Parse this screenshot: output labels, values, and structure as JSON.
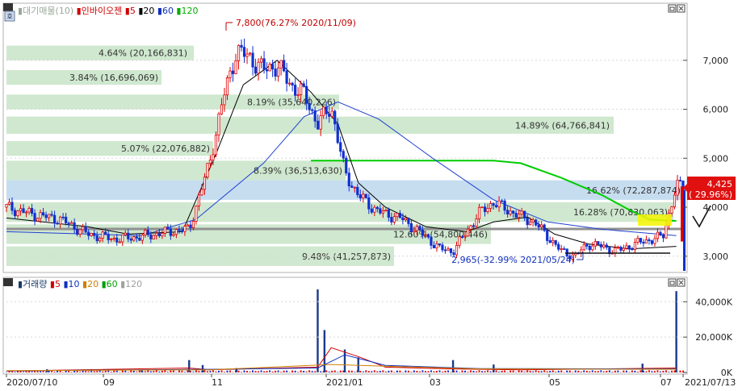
{
  "price_panel": {
    "legend": [
      {
        "text": "대기매물(10)",
        "color": "#9aa89a"
      },
      {
        "text": "인바이오젠",
        "color": "#d00000"
      },
      {
        "text": "5",
        "color": "#d00000"
      },
      {
        "text": "20",
        "color": "#000000"
      },
      {
        "text": "60",
        "color": "#1030c0"
      },
      {
        "text": "120",
        "color": "#00b000"
      }
    ],
    "y_ticks": [
      "7,000",
      "6,000",
      "5,000",
      "4,000",
      "3,000"
    ],
    "current_price_badge": {
      "price": "4,425",
      "change": "( 29.96%)",
      "color": "#e01010"
    },
    "max_annotation": "7,800(76.27% 2020/11/09)",
    "min_annotation": "2,965(-32.99% 2021/05/24)",
    "check_icon": "check-mark"
  },
  "volume_panel": {
    "legend": [
      {
        "text": "거래량",
        "color": "#1a3a6a"
      },
      {
        "text": "5",
        "color": "#d00000"
      },
      {
        "text": "10",
        "color": "#1030c0"
      },
      {
        "text": "20",
        "color": "#d08000"
      },
      {
        "text": "60",
        "color": "#00a000"
      },
      {
        "text": "120",
        "color": "#a0a0a0"
      }
    ],
    "y_ticks": [
      "40,000K",
      "20,000K",
      "0K"
    ]
  },
  "x_axis": {
    "ticks": [
      {
        "label": "2020/07/10"
      },
      {
        "label": "09"
      },
      {
        "label": "11"
      },
      {
        "label": "2021/01"
      },
      {
        "label": "03"
      },
      {
        "label": "05"
      },
      {
        "label": "07"
      },
      {
        "label": "2021/07/13"
      }
    ]
  },
  "chart_data": {
    "type": "candlestick",
    "title": "인바이오젠",
    "supply_zones": [
      {
        "label": "4.64% (20,166,831)",
        "price_low": 7000,
        "price_high": 7300,
        "highlight": false
      },
      {
        "label": "3.84% (16,696,069)",
        "price_low": 6500,
        "price_high": 6800,
        "highlight": false
      },
      {
        "label": "8.19% (35,640,226)",
        "price_low": 6000,
        "price_high": 6300,
        "highlight": false
      },
      {
        "label": "14.89% (64,766,841)",
        "price_low": 5500,
        "price_high": 5850,
        "highlight": false
      },
      {
        "label": "5.07% (22,076,882)",
        "price_low": 5050,
        "price_high": 5350,
        "highlight": false
      },
      {
        "label": "8.39% (36,513,630)",
        "price_low": 4550,
        "price_high": 4950,
        "highlight": false
      },
      {
        "label": "16.62% (72,287,874)",
        "price_low": 4150,
        "price_high": 4550,
        "highlight": true
      },
      {
        "label": "16.28% (70,830,063)",
        "price_low": 3700,
        "price_high": 4100,
        "highlight": false
      },
      {
        "label": "12.60% (54,800,446)",
        "price_low": 3250,
        "price_high": 3650,
        "highlight": false
      },
      {
        "label": "9.48% (41,257,873)",
        "price_low": 2800,
        "price_high": 3200,
        "highlight": false
      }
    ],
    "current_price": 4425,
    "current_change_pct": 29.96,
    "max_point": {
      "price": 7800,
      "pct": 76.27,
      "date": "2020/11/09"
    },
    "min_point": {
      "price": 2965,
      "pct": -32.99,
      "date": "2021/05/24"
    },
    "price_axis": {
      "min": 2700,
      "max": 8100
    },
    "volume_axis": {
      "min": 0,
      "max": 52000
    },
    "ma120_path": [
      [
        0.45,
        4950
      ],
      [
        0.72,
        4950
      ],
      [
        0.76,
        4900
      ],
      [
        0.82,
        4600
      ],
      [
        0.88,
        4250
      ],
      [
        0.92,
        3950
      ],
      [
        0.95,
        3750
      ],
      [
        0.99,
        3720
      ]
    ],
    "ma60_path": [
      [
        0.0,
        3500
      ],
      [
        0.2,
        3420
      ],
      [
        0.28,
        3750
      ],
      [
        0.38,
        4900
      ],
      [
        0.44,
        5850
      ],
      [
        0.49,
        6150
      ],
      [
        0.55,
        5800
      ],
      [
        0.63,
        5000
      ],
      [
        0.72,
        4150
      ],
      [
        0.8,
        3700
      ],
      [
        0.88,
        3550
      ],
      [
        0.99,
        3420
      ]
    ],
    "ma20_path": [
      [
        0.0,
        3780
      ],
      [
        0.12,
        3600
      ],
      [
        0.18,
        3450
      ],
      [
        0.26,
        3500
      ],
      [
        0.31,
        5100
      ],
      [
        0.35,
        6500
      ],
      [
        0.4,
        7000
      ],
      [
        0.45,
        6350
      ],
      [
        0.49,
        5700
      ],
      [
        0.52,
        4500
      ],
      [
        0.56,
        4000
      ],
      [
        0.62,
        3600
      ],
      [
        0.68,
        3500
      ],
      [
        0.72,
        3700
      ],
      [
        0.77,
        3800
      ],
      [
        0.81,
        3450
      ],
      [
        0.86,
        3250
      ],
      [
        0.92,
        3150
      ],
      [
        0.99,
        3200
      ]
    ],
    "close_series": [
      [
        0.0,
        4000
      ],
      [
        0.04,
        3850
      ],
      [
        0.08,
        3750
      ],
      [
        0.12,
        3450
      ],
      [
        0.16,
        3350
      ],
      [
        0.2,
        3400
      ],
      [
        0.24,
        3500
      ],
      [
        0.27,
        3550
      ],
      [
        0.3,
        4900
      ],
      [
        0.32,
        6200
      ],
      [
        0.34,
        7200
      ],
      [
        0.36,
        7050
      ],
      [
        0.38,
        6800
      ],
      [
        0.4,
        6900
      ],
      [
        0.42,
        6500
      ],
      [
        0.44,
        6300
      ],
      [
        0.46,
        5700
      ],
      [
        0.48,
        6050
      ],
      [
        0.5,
        4700
      ],
      [
        0.52,
        4250
      ],
      [
        0.54,
        4000
      ],
      [
        0.56,
        3850
      ],
      [
        0.58,
        3800
      ],
      [
        0.6,
        3600
      ],
      [
        0.62,
        3400
      ],
      [
        0.64,
        3150
      ],
      [
        0.66,
        3100
      ],
      [
        0.68,
        3500
      ],
      [
        0.7,
        3900
      ],
      [
        0.72,
        4100
      ],
      [
        0.74,
        3950
      ],
      [
        0.76,
        3800
      ],
      [
        0.78,
        3700
      ],
      [
        0.8,
        3400
      ],
      [
        0.82,
        3100
      ],
      [
        0.84,
        3000
      ],
      [
        0.86,
        3250
      ],
      [
        0.88,
        3200
      ],
      [
        0.9,
        3100
      ],
      [
        0.92,
        3200
      ],
      [
        0.94,
        3300
      ],
      [
        0.97,
        3400
      ],
      [
        0.99,
        4425
      ]
    ],
    "volume_spikes": [
      [
        0.06,
        1800
      ],
      [
        0.2,
        1500
      ],
      [
        0.27,
        7000
      ],
      [
        0.29,
        4200
      ],
      [
        0.34,
        2500
      ],
      [
        0.46,
        47000
      ],
      [
        0.47,
        24000
      ],
      [
        0.5,
        13000
      ],
      [
        0.52,
        8500
      ],
      [
        0.66,
        7000
      ],
      [
        0.72,
        4500
      ],
      [
        0.94,
        5000
      ],
      [
        0.99,
        46000
      ]
    ]
  }
}
